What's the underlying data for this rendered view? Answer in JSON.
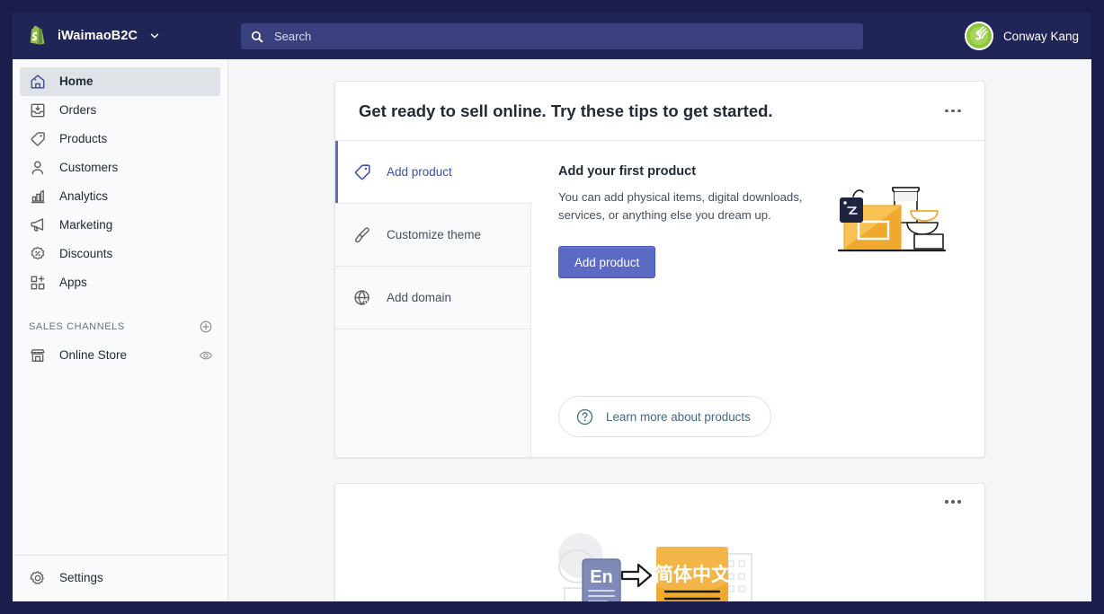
{
  "topbar": {
    "logo_icon": "shopify-bag-logo",
    "store_name": "iWaimaoB2C",
    "store_chevron_icon": "chevron-down-icon",
    "search": {
      "icon": "search-icon",
      "placeholder": "Search",
      "value": ""
    },
    "user": {
      "avatar_icon": "user-avatar",
      "name": "Conway Kang"
    }
  },
  "sidebar": {
    "items": [
      {
        "label": "Home",
        "icon": "home-icon",
        "active": true
      },
      {
        "label": "Orders",
        "icon": "orders-icon",
        "active": false
      },
      {
        "label": "Products",
        "icon": "products-tag-icon",
        "active": false
      },
      {
        "label": "Customers",
        "icon": "customers-icon",
        "active": false
      },
      {
        "label": "Analytics",
        "icon": "analytics-bar-chart-icon",
        "active": false
      },
      {
        "label": "Marketing",
        "icon": "marketing-megaphone-icon",
        "active": false
      },
      {
        "label": "Discounts",
        "icon": "discounts-percent-icon",
        "active": false
      },
      {
        "label": "Apps",
        "icon": "apps-grid-plus-icon",
        "active": false
      }
    ],
    "sales_channels": {
      "title": "SALES CHANNELS",
      "add_icon": "plus-circle-icon",
      "channels": [
        {
          "label": "Online Store",
          "icon": "storefront-icon",
          "action_icon": "eye-icon"
        }
      ]
    },
    "settings": {
      "label": "Settings",
      "icon": "gear-icon"
    }
  },
  "main": {
    "onboarding_card": {
      "title": "Get ready to sell online. Try these tips to get started.",
      "menu_icon": "kebab-menu-icon",
      "tasks": [
        {
          "label": "Add product",
          "icon": "tag-icon",
          "selected": true
        },
        {
          "label": "Customize theme",
          "icon": "paintbrush-icon",
          "selected": false
        },
        {
          "label": "Add domain",
          "icon": "globe-cursor-icon",
          "selected": false
        }
      ],
      "detail": {
        "title": "Add your first product",
        "description": "You can add physical items, digital downloads, services, or anything else you dream up.",
        "primary_button": "Add product",
        "illustration_icon": "product-box-illustration",
        "learn_more": {
          "icon": "question-circle-icon",
          "label": "Learn more about products"
        }
      }
    },
    "translation_card": {
      "menu_icon": "kebab-menu-icon",
      "illustration_icon": "translate-en-to-chinese-illustration",
      "source_label": "En",
      "target_label": "简体中文"
    }
  },
  "colors": {
    "topbar_bg": "#212457",
    "search_bg": "#3a3f7e",
    "page_bg": "#f4f6f8",
    "sidebar_bg": "#f9fafb",
    "accent_indigo": "#5c6ac4",
    "nav_active_bg": "#dfe3e8",
    "illustration_orange": "#f0a92f",
    "learn_text": "#43697f"
  }
}
